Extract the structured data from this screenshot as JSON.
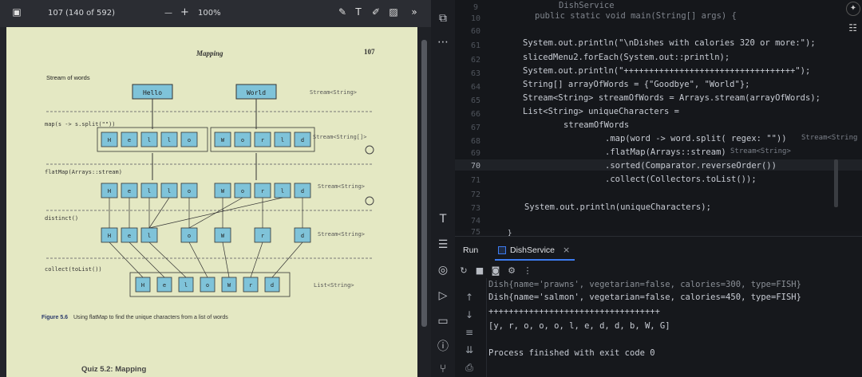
{
  "pdf": {
    "toolbar": {
      "page_number": "107",
      "page_of": "(140 of 592)",
      "zoom": "100%",
      "zoom_out_label": "—",
      "zoom_in_label": "+"
    },
    "page": {
      "header": "Mapping",
      "page_num": "107",
      "stream_of_words_label": "Stream of words",
      "word1": "Hello",
      "word2": "World",
      "type_stream_string": "Stream<String>",
      "type_stream_string_array": "Stream<String[]>",
      "type_list_string": "List<String>",
      "op_map": "map(s -> s.split(\"\"))",
      "op_flatmap": "flatMap(Arrays::stream)",
      "op_distinct": "distinct()",
      "op_collect": "collect(toList())",
      "row_hello": [
        "H",
        "e",
        "l",
        "l",
        "o"
      ],
      "row_world": [
        "W",
        "o",
        "r",
        "l",
        "d"
      ],
      "row_flat": [
        "H",
        "e",
        "l",
        "l",
        "o",
        "W",
        "o",
        "r",
        "l",
        "d"
      ],
      "row_distinct": [
        "H",
        "e",
        "l",
        "o",
        "W",
        "r",
        "d"
      ],
      "row_collected": [
        "H",
        "e",
        "l",
        "o",
        "W",
        "r",
        "d"
      ],
      "caption_bold": "Figure 5.6",
      "caption_text": "Using flatMap to find the unique characters from a list of words",
      "quiz_title": "Quiz 5.2: Mapping"
    }
  },
  "ide": {
    "breadcrumb_class": "DishService",
    "line_numbers": [
      "9",
      "10",
      "60",
      "61",
      "62",
      "63",
      "64",
      "65",
      "66",
      "67",
      "68",
      "69",
      "70",
      "71",
      "72",
      "73",
      "74",
      "75"
    ],
    "code_lines": {
      "l10": "public static void main(String[] args) {",
      "l61": "System.out.println(\"\\nDishes with calories 320 or more:\");",
      "l62": "slicedMenu2.forEach(System.out::println);",
      "l63": "System.out.println(\"++++++++++++++++++++++++++++++++++\");",
      "l64": "String[] arrayOfWords = {\"Goodbye\", \"World\"};",
      "l65": "Stream<String> streamOfWords = Arrays.stream(arrayOfWords);",
      "l66": "List<String> uniqueCharacters =",
      "l67": "streamOfWords",
      "l68": ".map(word -> word.split( regex: \"\"))",
      "l68_hint": "Stream<String",
      "l69": ".flatMap(Arrays::stream)",
      "l69_hint": "Stream<String>",
      "l70": ".sorted(Comparator.reverseOrder())",
      "l71": ".collect(Collectors.toList());",
      "l73": "System.out.println(uniqueCharacters);",
      "l75": "}"
    },
    "run": {
      "tab_run": "Run",
      "tab_config": "DishService",
      "output": [
        "Dish{name='prawns', vegetarian=false, calories=300, type=FISH}",
        "Dish{name='salmon', vegetarian=false, calories=450, type=FISH}",
        "++++++++++++++++++++++++++++++++++",
        "[y, r, o, o, o, l, e, d, d, b, W, G]",
        "",
        "Process finished with exit code 0"
      ]
    }
  }
}
